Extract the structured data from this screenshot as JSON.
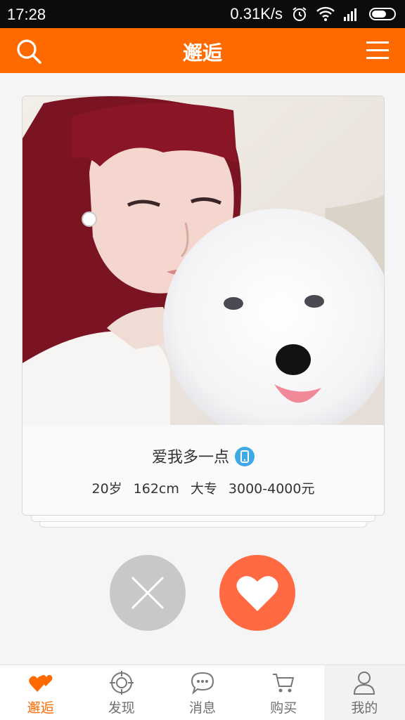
{
  "status_bar": {
    "time": "17:28",
    "network_speed": "0.31K/s",
    "icons": [
      "alarm-icon",
      "wifi-icon",
      "signal-icon",
      "battery-icon"
    ]
  },
  "header": {
    "title": "邂逅",
    "left_icon": "search-icon",
    "right_icon": "menu-icon"
  },
  "profile_card": {
    "photo": "photo of a woman with red hair holding a white fluffy dog",
    "name": "爱我多一点",
    "verified_icon": "phone-verified-icon",
    "age": "20岁",
    "height": "162cm",
    "education": "大专",
    "income": "3000-4000元"
  },
  "actions": {
    "dislike_icon": "close-icon",
    "like_icon": "heart-icon"
  },
  "tabs": [
    {
      "label": "邂逅",
      "icon": "hearts-icon",
      "active": true
    },
    {
      "label": "发现",
      "icon": "target-icon",
      "active": false
    },
    {
      "label": "消息",
      "icon": "chat-bubble-icon",
      "active": false
    },
    {
      "label": "购买",
      "icon": "cart-icon",
      "active": false
    },
    {
      "label": "我的",
      "icon": "user-icon",
      "active": false
    }
  ],
  "colors": {
    "accent": "#ff6a00",
    "like": "#ff6a43",
    "dislike": "#c8c8c8",
    "verified": "#3fa9e8"
  }
}
